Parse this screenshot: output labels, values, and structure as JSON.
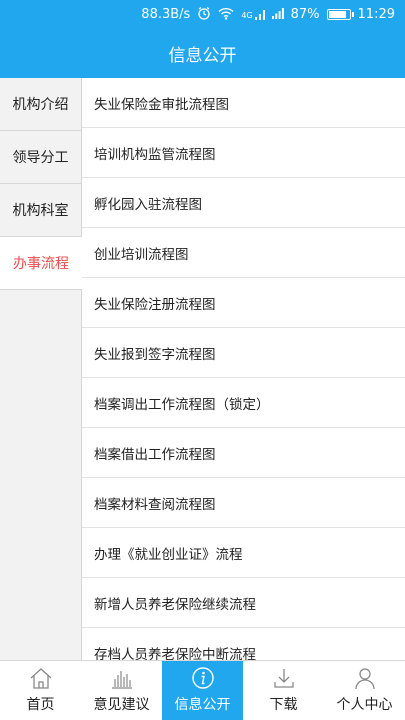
{
  "status": {
    "speed": "88.3B/s",
    "signal_label": "4G",
    "battery": "87%",
    "battery_level": 0.87,
    "time": "11:29"
  },
  "header": {
    "title": "信息公开"
  },
  "sidebar": {
    "items": [
      {
        "label": "机构介绍"
      },
      {
        "label": "领导分工"
      },
      {
        "label": "机构科室"
      },
      {
        "label": "办事流程"
      }
    ]
  },
  "list": {
    "items": [
      "失业保险金审批流程图",
      "培训机构监管流程图",
      "孵化园入驻流程图",
      "创业培训流程图",
      "失业保险注册流程图",
      "失业报到签字流程图",
      "档案调出工作流程图（锁定）",
      "档案借出工作流程图",
      "档案材料查阅流程图",
      "办理《就业创业证》流程",
      "新增人员养老保险继续流程",
      "存档人员养老保险中断流程"
    ]
  },
  "tabbar": {
    "items": [
      {
        "label": "首页",
        "icon": "home-icon"
      },
      {
        "label": "意见建议",
        "icon": "bar-chart-icon"
      },
      {
        "label": "信息公开",
        "icon": "info-icon"
      },
      {
        "label": "下载",
        "icon": "download-icon"
      },
      {
        "label": "个人中心",
        "icon": "person-icon"
      }
    ]
  },
  "colors": {
    "primary": "#20a7ee",
    "active_text": "#ef4b4b"
  }
}
